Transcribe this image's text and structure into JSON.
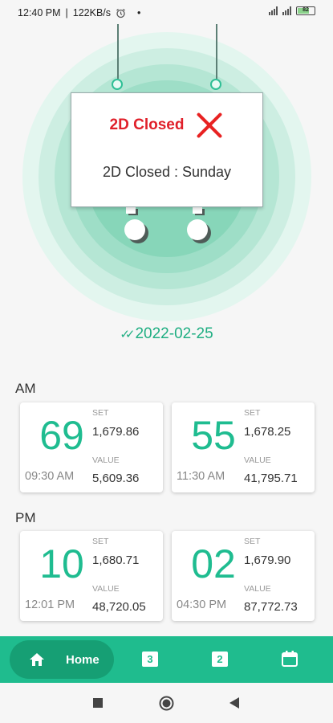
{
  "status_bar": {
    "time": "12:40 PM",
    "speed": "122KB/s",
    "battery": "82"
  },
  "dialog": {
    "title": "2D Closed",
    "message": "2D Closed : Sunday"
  },
  "date": "2022-02-25",
  "am": {
    "label": "AM",
    "cards": [
      {
        "number": "69",
        "time": "09:30 AM",
        "set_label": "SET",
        "set": "1,679.86",
        "value_label": "VALUE",
        "value": "5,609.36"
      },
      {
        "number": "55",
        "time": "11:30 AM",
        "set_label": "SET",
        "set": "1,678.25",
        "value_label": "VALUE",
        "value": "41,795.71"
      }
    ]
  },
  "pm": {
    "label": "PM",
    "cards": [
      {
        "number": "10",
        "time": "12:01 PM",
        "set_label": "SET",
        "set": "1,680.71",
        "value_label": "VALUE",
        "value": "48,720.05"
      },
      {
        "number": "02",
        "time": "04:30 PM",
        "set_label": "SET",
        "set": "1,679.90",
        "value_label": "VALUE",
        "value": "87,772.73"
      }
    ]
  },
  "bottom_nav": {
    "home_label": "Home",
    "tab3": "3",
    "tab2": "2",
    "icons": [
      "home-icon",
      "three-d-icon",
      "two-d-icon",
      "calendar-icon"
    ]
  },
  "colors": {
    "accent": "#1fbc8e",
    "accent_dark": "#169f74",
    "closed_red": "#e0202a"
  }
}
